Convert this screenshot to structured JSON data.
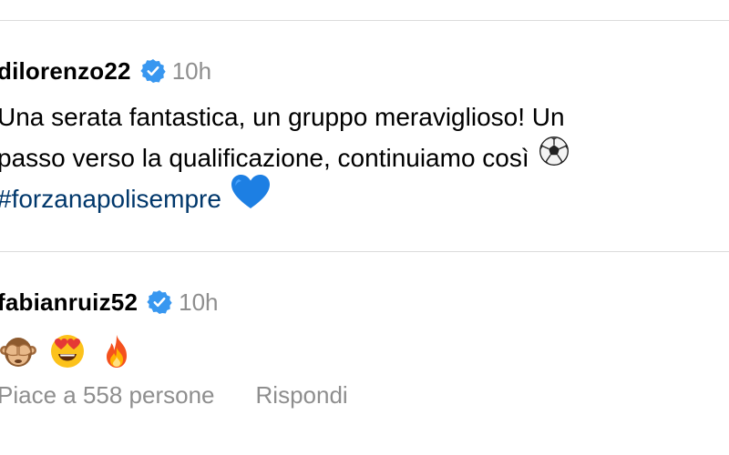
{
  "comments": [
    {
      "username": "dilorenzo22",
      "verified": true,
      "time": "10h",
      "text_line1": "Una serata fantastica, un gruppo meraviglioso! Un",
      "text_line2": "passo verso la qualificazione, continuiamo così",
      "text_line2_emoji": "soccer-ball-icon",
      "hashtag": "#forzanapolisempre",
      "hashtag_emoji": "blue-heart-icon"
    },
    {
      "username": "fabianruiz52",
      "verified": true,
      "time": "10h",
      "emojis": [
        "see-no-evil-monkey-icon",
        "heart-eyes-face-icon",
        "fire-icon"
      ],
      "likes": "Piace a 558 persone",
      "reply": "Rispondi"
    }
  ],
  "colors": {
    "verified_badge": "#3897f0",
    "hashtag": "#00376b",
    "secondary_text": "#8e8e8e",
    "divider": "#dbdbdb"
  }
}
